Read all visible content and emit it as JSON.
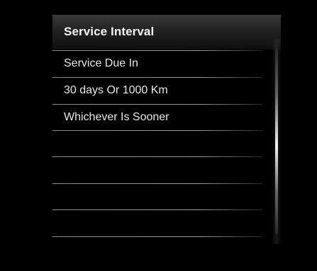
{
  "header": {
    "title": "Service Interval"
  },
  "list": {
    "items": [
      {
        "label": "Service Due In"
      },
      {
        "label": "30 days Or 1000 Km"
      },
      {
        "label": "Whichever Is Sooner"
      },
      {
        "label": ""
      },
      {
        "label": ""
      },
      {
        "label": ""
      },
      {
        "label": ""
      }
    ]
  },
  "colors": {
    "background": "#000000",
    "text": "#e6e6e6",
    "divider": "#9a9a9a"
  }
}
